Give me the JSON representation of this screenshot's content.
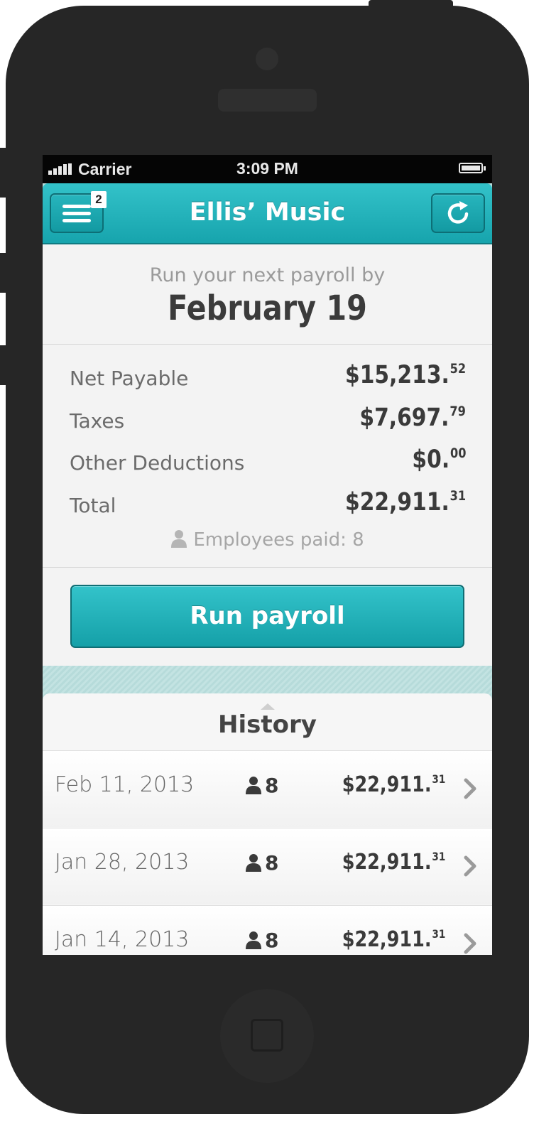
{
  "status_bar": {
    "carrier": "Carrier",
    "time": "3:09 PM"
  },
  "nav": {
    "title": "Ellis’ Music",
    "menu_badge": "2",
    "menu_icon": "hamburger-icon",
    "refresh_icon": "refresh-icon"
  },
  "payroll": {
    "due_label": "Run your next payroll by",
    "due_date": "February 19",
    "rows": [
      {
        "label": "Net Payable",
        "dollars": "$15,213.",
        "cents": "52"
      },
      {
        "label": "Taxes",
        "dollars": "$7,697.",
        "cents": "79"
      },
      {
        "label": "Other Deductions",
        "dollars": "$0.",
        "cents": "00"
      },
      {
        "label": "Total",
        "dollars": "$22,911.",
        "cents": "31"
      }
    ],
    "employees_paid": "Employees paid: 8",
    "run_button": "Run payroll"
  },
  "history": {
    "title": "History",
    "rows": [
      {
        "date": "Feb 11, 2013",
        "employees": "8",
        "dollars": "$22,911.",
        "cents": "31"
      },
      {
        "date": "Jan 28, 2013",
        "employees": "8",
        "dollars": "$22,911.",
        "cents": "31"
      },
      {
        "date": "Jan 14, 2013",
        "employees": "8",
        "dollars": "$22,911.",
        "cents": "31"
      }
    ]
  },
  "colors": {
    "accent": "#1fb0b8",
    "accent_dark": "#0f7b82",
    "phone_body": "#262626"
  }
}
